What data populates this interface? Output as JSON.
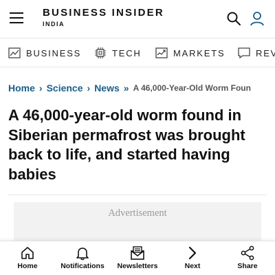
{
  "header": {
    "brand_name": "BUSINESS INSIDER",
    "brand_sub": "INDIA",
    "menu_icon": "hamburger-menu-icon",
    "search_icon": "search-icon",
    "user_icon": "user-icon"
  },
  "categories": [
    {
      "label": "BUSINESS",
      "icon": "chart-icon"
    },
    {
      "label": "TECH",
      "icon": "chip-icon"
    },
    {
      "label": "MARKETS",
      "icon": "market-trend-icon"
    },
    {
      "label": "REV",
      "icon": "review-icon"
    }
  ],
  "breadcrumb": {
    "home": "Home",
    "science": "Science",
    "news": "News",
    "sep1": "›",
    "sep2": "›",
    "sep3": "»",
    "current": "A 46,000-Year-Old Worm Foun"
  },
  "article": {
    "headline": "A 46,000-year-old worm found in Siberian permafrost was brought back to life, and started having babies"
  },
  "ad": {
    "label": "Advertisement"
  },
  "bottom_nav": [
    {
      "label": "Home",
      "icon": "home-icon"
    },
    {
      "label": "Notifications",
      "icon": "bell-icon"
    },
    {
      "label": "Newsletters",
      "icon": "newsletter-icon"
    },
    {
      "label": "Next",
      "icon": "chevron-right-icon"
    },
    {
      "label": "Share",
      "icon": "share-icon"
    }
  ],
  "colors": {
    "link": "#1a5e8a",
    "text": "#111111",
    "ad_bg": "#f2f2f2"
  }
}
